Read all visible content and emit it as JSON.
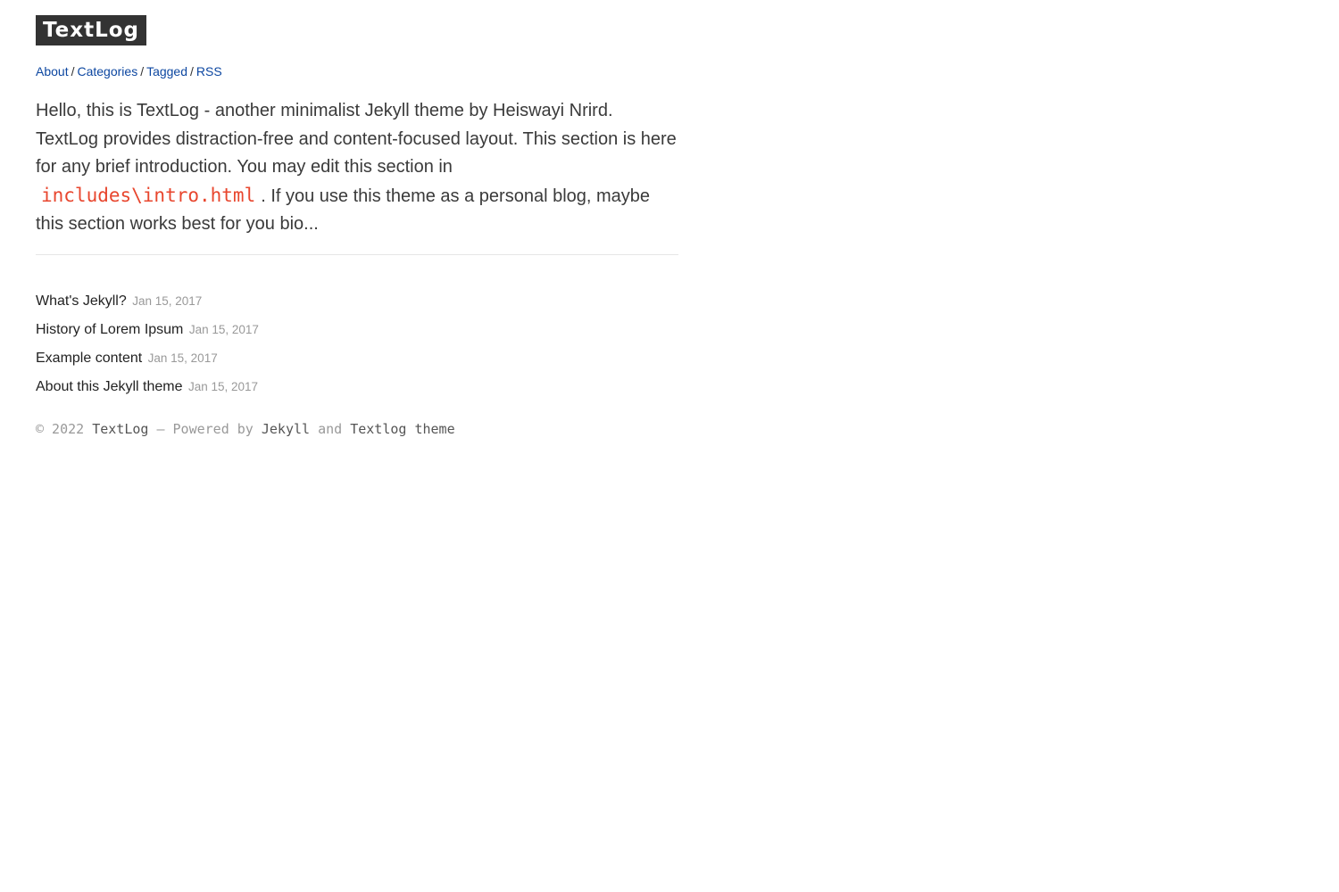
{
  "header": {
    "site_title": "TextLog"
  },
  "nav": {
    "items": [
      {
        "label": "About"
      },
      {
        "label": "Categories"
      },
      {
        "label": "Tagged"
      },
      {
        "label": "RSS"
      }
    ],
    "separator": "/"
  },
  "intro": {
    "text_before": "Hello, this is TextLog - another minimalist Jekyll theme by Heiswayi Nrird. TextLog provides distraction-free and content-focused layout. This section is here for any brief introduction. You may edit this section in",
    "code": "includes\\intro.html",
    "text_after": ". If you use this theme as a personal blog, maybe this section works best for you bio..."
  },
  "posts": [
    {
      "title": "What's Jekyll?",
      "date": "Jan 15, 2017"
    },
    {
      "title": "History of Lorem Ipsum",
      "date": "Jan 15, 2017"
    },
    {
      "title": "Example content",
      "date": "Jan 15, 2017"
    },
    {
      "title": "About this Jekyll theme",
      "date": "Jan 15, 2017"
    }
  ],
  "footer": {
    "copyright": "© 2022",
    "site_link": "TextLog",
    "powered_by": "— Powered by",
    "jekyll_link": "Jekyll",
    "and": "and",
    "theme_link": "Textlog theme"
  },
  "colors": {
    "link": "#0d47a1",
    "code": "#e8462e",
    "title_bg": "#333333"
  }
}
